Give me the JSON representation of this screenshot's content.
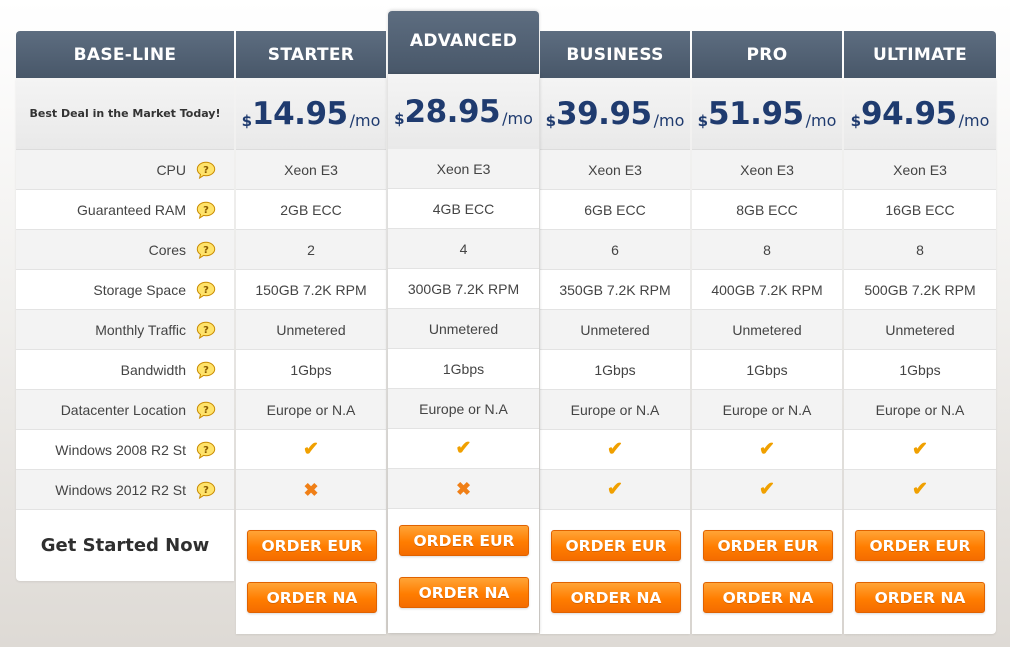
{
  "base": {
    "title": "BASE-LINE",
    "tagline": "Best Deal in the Market Today!",
    "cta": "Get Started Now",
    "features": [
      "CPU",
      "Guaranteed RAM",
      "Cores",
      "Storage Space",
      "Monthly Traffic",
      "Bandwidth",
      "Datacenter Location",
      "Windows 2008 R2 St",
      "Windows 2012 R2 St"
    ],
    "help_icon": "speech-bubble-question-icon"
  },
  "plans": [
    {
      "name": "STARTER",
      "currency": "$",
      "amount": "14.95",
      "period": "/mo",
      "values": [
        "Xeon E3",
        "2GB ECC",
        "2",
        "150GB 7.2K RPM",
        "Unmetered",
        "1Gbps",
        "Europe or N.A"
      ],
      "win2008": "check",
      "win2012": "cross",
      "order_eur": "ORDER EUR",
      "order_na": "ORDER NA"
    },
    {
      "name": "ADVANCED",
      "currency": "$",
      "amount": "28.95",
      "period": "/mo",
      "values": [
        "Xeon E3",
        "4GB ECC",
        "4",
        "300GB 7.2K RPM",
        "Unmetered",
        "1Gbps",
        "Europe or N.A"
      ],
      "win2008": "check",
      "win2012": "cross",
      "order_eur": "ORDER EUR",
      "order_na": "ORDER NA"
    },
    {
      "name": "BUSINESS",
      "currency": "$",
      "amount": "39.95",
      "period": "/mo",
      "values": [
        "Xeon E3",
        "6GB ECC",
        "6",
        "350GB 7.2K RPM",
        "Unmetered",
        "1Gbps",
        "Europe or N.A"
      ],
      "win2008": "check",
      "win2012": "check",
      "order_eur": "ORDER EUR",
      "order_na": "ORDER NA"
    },
    {
      "name": "PRO",
      "currency": "$",
      "amount": "51.95",
      "period": "/mo",
      "values": [
        "Xeon E3",
        "8GB ECC",
        "8",
        "400GB 7.2K RPM",
        "Unmetered",
        "1Gbps",
        "Europe or N.A"
      ],
      "win2008": "check",
      "win2012": "check",
      "order_eur": "ORDER EUR",
      "order_na": "ORDER NA"
    },
    {
      "name": "ULTIMATE",
      "currency": "$",
      "amount": "94.95",
      "period": "/mo",
      "values": [
        "Xeon E3",
        "16GB ECC",
        "8",
        "500GB 7.2K RPM",
        "Unmetered",
        "1Gbps",
        "Europe or N.A"
      ],
      "win2008": "check",
      "win2012": "check",
      "order_eur": "ORDER EUR",
      "order_na": "ORDER NA"
    }
  ],
  "symbols": {
    "check": "✔",
    "cross": "✖"
  },
  "colors": {
    "header": "#4f5e71",
    "price": "#1f3b6f",
    "button": "#ff8300",
    "check": "#f0a000"
  }
}
